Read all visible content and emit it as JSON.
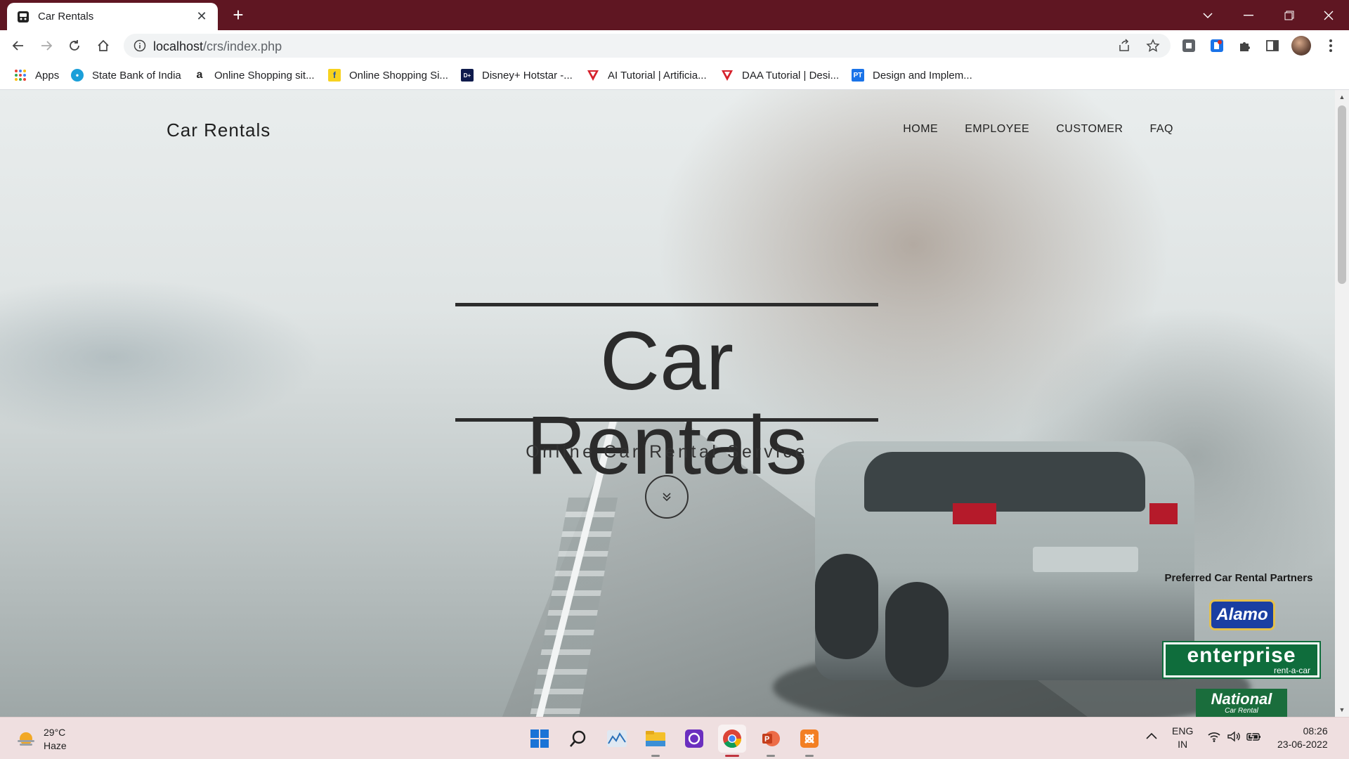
{
  "browser": {
    "tab_title": "Car Rentals",
    "url_host": "localhost",
    "url_path": "/crs/index.php"
  },
  "bookmarks": [
    {
      "label": "Apps",
      "icon": "apps-grid-icon",
      "color": "#ea4335"
    },
    {
      "label": "State Bank of India",
      "icon": "sbi-icon",
      "color": "#1a9fd9"
    },
    {
      "label": "Online Shopping sit...",
      "icon": "amazon-icon",
      "color": "#222222"
    },
    {
      "label": "Online Shopping Si...",
      "icon": "flipkart-icon",
      "color": "#f7d21f"
    },
    {
      "label": "Disney+ Hotstar -...",
      "icon": "hotstar-icon",
      "color": "#0f1b4c"
    },
    {
      "label": "AI Tutorial | Artificia...",
      "icon": "tutorial-icon",
      "color": "#d6212b"
    },
    {
      "label": "DAA Tutorial | Desi...",
      "icon": "tutorial-icon",
      "color": "#d6212b"
    },
    {
      "label": "Design and Implem...",
      "icon": "pt-icon",
      "color": "#1a73e8"
    }
  ],
  "site": {
    "brand": "Car Rentals",
    "nav": [
      "HOME",
      "EMPLOYEE",
      "CUSTOMER",
      "FAQ"
    ],
    "hero_title": "Car Rentals",
    "hero_subtitle": "Online Car Rental Service",
    "partners_title": "Preferred Car Rental Partners",
    "partners": {
      "alamo": "Alamo",
      "enterprise": "enterprise",
      "enterprise_sub": "rent-a-car",
      "national": "National",
      "national_sub": "Car Rental"
    }
  },
  "taskbar": {
    "weather_temp": "29°C",
    "weather_desc": "Haze",
    "apps": [
      "start-icon",
      "search-icon",
      "stocks-icon",
      "file-explorer-icon",
      "app-icon",
      "chrome-icon",
      "powerpoint-icon",
      "xampp-icon"
    ],
    "language": "ENG",
    "region": "IN",
    "time": "08:26",
    "date": "23-06-2022"
  },
  "colors": {
    "titlebar": "#5f1622",
    "taskbar": "#efdfe0",
    "enterprise_green": "#0f6d3c",
    "alamo_blue": "#1a3fa2"
  }
}
